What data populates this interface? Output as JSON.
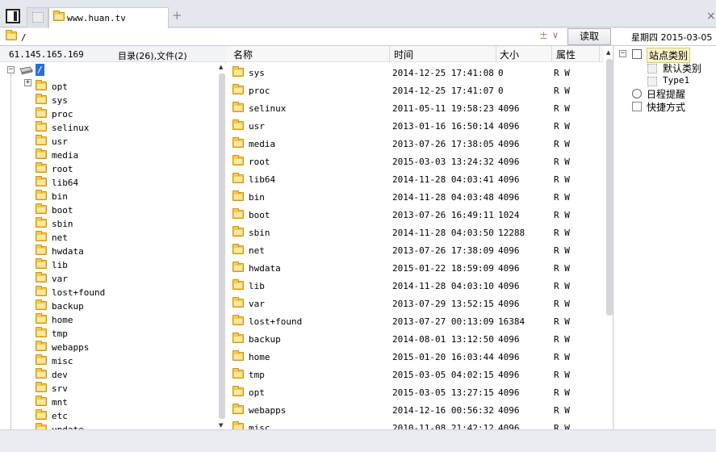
{
  "tabs": {
    "active_label": "www.huan.tv",
    "add_label": "+",
    "close_label": "×"
  },
  "address": {
    "value": "/",
    "plus_label": "±",
    "dropdown_label": "∨",
    "read_button": "读取",
    "date": "星期四 2015-03-05"
  },
  "left": {
    "server_ip": "61.145.165.169",
    "summary": "目录(26),文件(2)",
    "root_label": "/",
    "tree": [
      "opt",
      "sys",
      "proc",
      "selinux",
      "usr",
      "media",
      "root",
      "lib64",
      "bin",
      "boot",
      "sbin",
      "net",
      "hwdata",
      "lib",
      "var",
      "lost+found",
      "backup",
      "home",
      "tmp",
      "webapps",
      "misc",
      "dev",
      "srv",
      "mnt",
      "etc",
      "update"
    ],
    "opt_expander": "+",
    "root_expander": "−"
  },
  "files": {
    "headers": {
      "name": "名称",
      "time": "时间",
      "size": "大小",
      "attr": "属性"
    },
    "rows": [
      {
        "name": "sys",
        "time": "2014-12-25 17:41:08",
        "size": "0",
        "attr": "R W"
      },
      {
        "name": "proc",
        "time": "2014-12-25 17:41:07",
        "size": "0",
        "attr": "R W"
      },
      {
        "name": "selinux",
        "time": "2011-05-11 19:58:23",
        "size": "4096",
        "attr": "R W"
      },
      {
        "name": "usr",
        "time": "2013-01-16 16:50:14",
        "size": "4096",
        "attr": "R W"
      },
      {
        "name": "media",
        "time": "2013-07-26 17:38:05",
        "size": "4096",
        "attr": "R W"
      },
      {
        "name": "root",
        "time": "2015-03-03 13:24:32",
        "size": "4096",
        "attr": "R W"
      },
      {
        "name": "lib64",
        "time": "2014-11-28 04:03:41",
        "size": "4096",
        "attr": "R W"
      },
      {
        "name": "bin",
        "time": "2014-11-28 04:03:48",
        "size": "4096",
        "attr": "R W"
      },
      {
        "name": "boot",
        "time": "2013-07-26 16:49:11",
        "size": "1024",
        "attr": "R W"
      },
      {
        "name": "sbin",
        "time": "2014-11-28 04:03:50",
        "size": "12288",
        "attr": "R W"
      },
      {
        "name": "net",
        "time": "2013-07-26 17:38:09",
        "size": "4096",
        "attr": "R W"
      },
      {
        "name": "hwdata",
        "time": "2015-01-22 18:59:09",
        "size": "4096",
        "attr": "R W"
      },
      {
        "name": "lib",
        "time": "2014-11-28 04:03:10",
        "size": "4096",
        "attr": "R W"
      },
      {
        "name": "var",
        "time": "2013-07-29 13:52:15",
        "size": "4096",
        "attr": "R W"
      },
      {
        "name": "lost+found",
        "time": "2013-07-27 00:13:09",
        "size": "16384",
        "attr": "R W"
      },
      {
        "name": "backup",
        "time": "2014-08-01 13:12:50",
        "size": "4096",
        "attr": "R W"
      },
      {
        "name": "home",
        "time": "2015-01-20 16:03:44",
        "size": "4096",
        "attr": "R W"
      },
      {
        "name": "tmp",
        "time": "2015-03-05 04:02:15",
        "size": "4096",
        "attr": "R W"
      },
      {
        "name": "opt",
        "time": "2015-03-05 13:27:15",
        "size": "4096",
        "attr": "R W"
      },
      {
        "name": "webapps",
        "time": "2014-12-16 00:56:32",
        "size": "4096",
        "attr": "R W"
      },
      {
        "name": "misc",
        "time": "2010-11-08 21:42:12",
        "size": "4096",
        "attr": "R W"
      }
    ]
  },
  "side": {
    "site_category": "站点类别",
    "default_category": "默认类别",
    "type1": "Type1",
    "schedule": "日程提醒",
    "shortcuts": "快捷方式",
    "expander": "−"
  },
  "colors": {
    "selection": "#2a6fd6",
    "folder": "#f5c947"
  }
}
